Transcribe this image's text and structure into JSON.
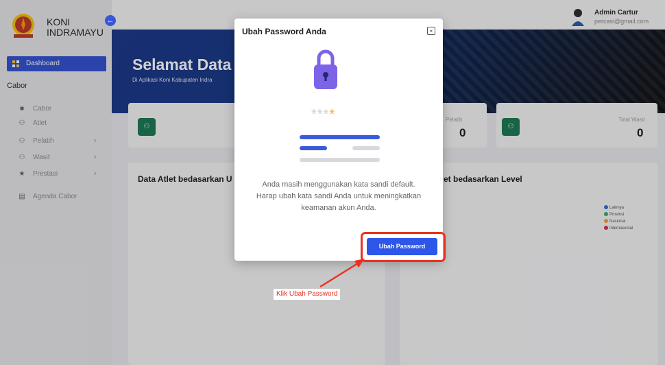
{
  "brand": {
    "line1": "KONI",
    "line2": "INDRAMAYU"
  },
  "sidebar": {
    "dashboard_label": "Dashboard",
    "section_title": "Cabor",
    "items": [
      {
        "label": "Cabor",
        "icon": "box-icon",
        "has_children": false
      },
      {
        "label": "Atlet",
        "icon": "users-icon",
        "has_children": false
      },
      {
        "label": "Pelatih",
        "icon": "users-icon",
        "has_children": true
      },
      {
        "label": "Wasit",
        "icon": "users-icon",
        "has_children": true
      },
      {
        "label": "Prestasi",
        "icon": "star-icon",
        "has_children": true
      },
      {
        "label": "Agenda Cabor",
        "icon": "calendar-icon",
        "has_children": false
      }
    ]
  },
  "user": {
    "name": "Admin Cartur",
    "email": "percasi@gmail.com"
  },
  "banner": {
    "title": "Selamat Data",
    "subtitle": "Di Aplikasi Koni Kabupaten Indra"
  },
  "stats": [
    {
      "label": "Pelatih",
      "value": "0"
    },
    {
      "label": "Total Wasit",
      "value": "0"
    }
  ],
  "panels": {
    "left_title": "Data Atlet bedasarkan U",
    "right_title": "et bedasarkan Level",
    "legend": [
      {
        "label": "Lainnya",
        "color": "#3b6fd4"
      },
      {
        "label": "Provinsi",
        "color": "#34b36b"
      },
      {
        "label": "Nasional",
        "color": "#f0a23a"
      },
      {
        "label": "Internasional",
        "color": "#d6304d"
      }
    ]
  },
  "modal": {
    "title": "Ubah Password Anda",
    "close_label": "×",
    "stars": "***",
    "star_highlight": "*",
    "message_line1": "Anda masih menggunakan kata sandi default.",
    "message_line2": "Harap ubah kata sandi Anda untuk meningkatkan",
    "message_line3": "keamanan akun Anda.",
    "button_label": "Ubah Password"
  },
  "annotation": {
    "label": "Klik Ubah Password",
    "color": "#e8321f"
  }
}
